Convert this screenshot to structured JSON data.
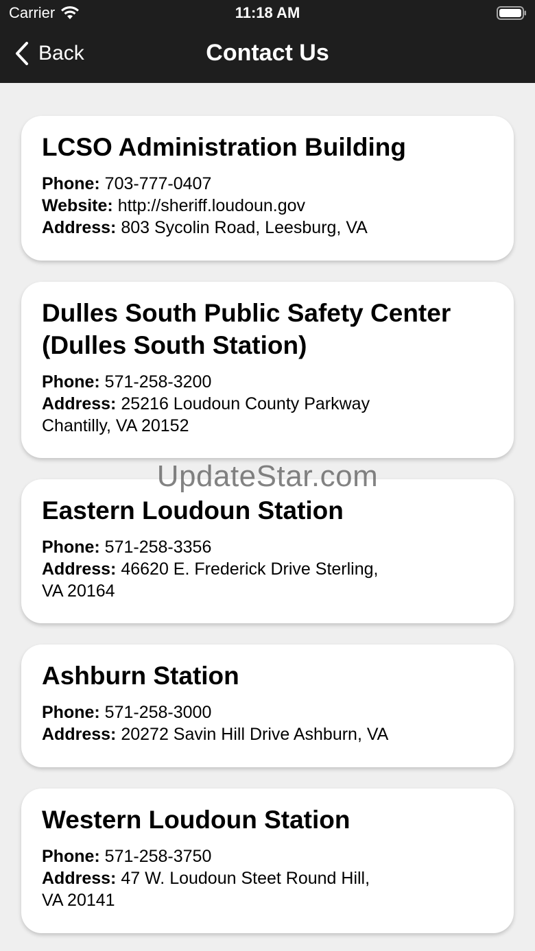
{
  "status_bar": {
    "carrier": "Carrier",
    "time": "11:18 AM"
  },
  "nav": {
    "back_label": "Back",
    "title": "Contact Us"
  },
  "labels": {
    "phone": "Phone:",
    "website": "Website:",
    "address": "Address:"
  },
  "locations": [
    {
      "name": "LCSO Administration Building",
      "phone": "703-777-0407",
      "website": "http://sheriff.loudoun.gov",
      "address": "803 Sycolin Road, Leesburg, VA"
    },
    {
      "name_line1": "Dulles South Public Safety Center",
      "name_line2": "(Dulles South Station)",
      "phone": "571-258-3200",
      "address_line1": "25216 Loudoun County Parkway",
      "address_line2": "Chantilly, VA 20152"
    },
    {
      "name": "Eastern Loudoun Station",
      "phone": "571-258-3356",
      "address_line1": "46620 E. Frederick Drive Sterling,",
      "address_line2": "VA 20164"
    },
    {
      "name": "Ashburn Station",
      "phone": "571-258-3000",
      "address": "20272 Savin Hill Drive Ashburn, VA"
    },
    {
      "name": "Western Loudoun Station",
      "phone": "571-258-3750",
      "address_line1": "47 W. Loudoun Steet Round Hill,",
      "address_line2": "VA 20141"
    }
  ],
  "watermark": "UpdateStar.com"
}
